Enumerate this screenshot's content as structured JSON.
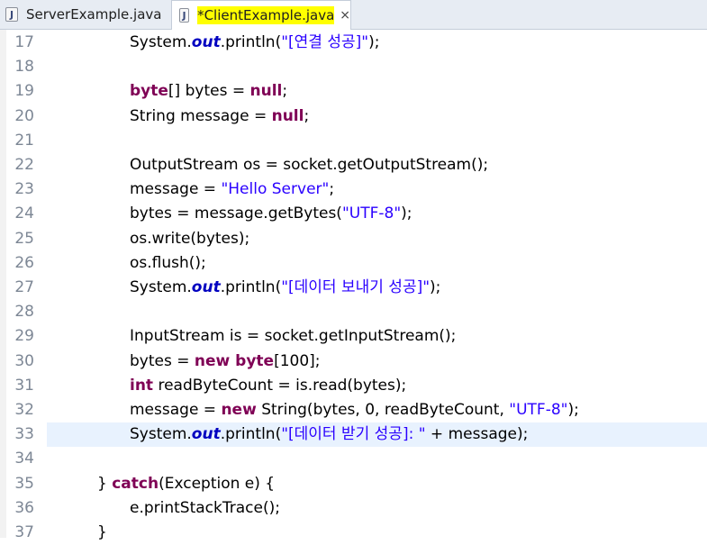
{
  "tabs": [
    {
      "label": "ServerExample.java",
      "icon": "java-file-icon"
    },
    {
      "label": "*ClientExample.java",
      "icon": "java-file-icon",
      "close": "⨯"
    }
  ],
  "lines": [
    {
      "num": "17",
      "indent": 2,
      "tokens": [
        [
          "t",
          "System."
        ],
        [
          "f",
          "out"
        ],
        [
          "t",
          ".println("
        ],
        [
          "s",
          "\"[연결 성공]\""
        ],
        [
          "t",
          ");"
        ]
      ]
    },
    {
      "num": "18",
      "indent": 2,
      "tokens": []
    },
    {
      "num": "19",
      "indent": 2,
      "tokens": [
        [
          "k",
          "byte"
        ],
        [
          "t",
          "[] bytes = "
        ],
        [
          "k",
          "null"
        ],
        [
          "t",
          ";"
        ]
      ]
    },
    {
      "num": "20",
      "indent": 2,
      "tokens": [
        [
          "t",
          "String message = "
        ],
        [
          "k",
          "null"
        ],
        [
          "t",
          ";"
        ]
      ]
    },
    {
      "num": "21",
      "indent": 2,
      "tokens": []
    },
    {
      "num": "22",
      "indent": 2,
      "tokens": [
        [
          "t",
          "OutputStream os = socket.getOutputStream();"
        ]
      ]
    },
    {
      "num": "23",
      "indent": 2,
      "tokens": [
        [
          "t",
          "message = "
        ],
        [
          "s",
          "\"Hello Server\""
        ],
        [
          "t",
          ";"
        ]
      ]
    },
    {
      "num": "24",
      "indent": 2,
      "tokens": [
        [
          "t",
          "bytes = message.getBytes("
        ],
        [
          "s",
          "\"UTF-8\""
        ],
        [
          "t",
          ");"
        ]
      ]
    },
    {
      "num": "25",
      "indent": 2,
      "tokens": [
        [
          "t",
          "os.write(bytes);"
        ]
      ]
    },
    {
      "num": "26",
      "indent": 2,
      "tokens": [
        [
          "t",
          "os.flush();"
        ]
      ]
    },
    {
      "num": "27",
      "indent": 2,
      "tokens": [
        [
          "t",
          "System."
        ],
        [
          "f",
          "out"
        ],
        [
          "t",
          ".println("
        ],
        [
          "s",
          "\"[데이터 보내기 성공]\""
        ],
        [
          "t",
          ");"
        ]
      ]
    },
    {
      "num": "28",
      "indent": 2,
      "tokens": []
    },
    {
      "num": "29",
      "indent": 2,
      "tokens": [
        [
          "t",
          "InputStream is = socket.getInputStream();"
        ]
      ]
    },
    {
      "num": "30",
      "indent": 2,
      "tokens": [
        [
          "t",
          "bytes = "
        ],
        [
          "k",
          "new byte"
        ],
        [
          "t",
          "[100];"
        ]
      ]
    },
    {
      "num": "31",
      "indent": 2,
      "tokens": [
        [
          "k",
          "int"
        ],
        [
          "t",
          " readByteCount = is.read(bytes);"
        ]
      ]
    },
    {
      "num": "32",
      "indent": 2,
      "tokens": [
        [
          "t",
          "message = "
        ],
        [
          "k",
          "new"
        ],
        [
          "t",
          " String(bytes, 0, readByteCount, "
        ],
        [
          "s",
          "\"UTF-8\""
        ],
        [
          "t",
          ");"
        ]
      ]
    },
    {
      "num": "33",
      "indent": 2,
      "current": true,
      "tokens": [
        [
          "t",
          "System."
        ],
        [
          "f",
          "out"
        ],
        [
          "t",
          ".println("
        ],
        [
          "s",
          "\"[데이터 받기 성공]: \""
        ],
        [
          "t",
          " + message);"
        ]
      ]
    },
    {
      "num": "34",
      "indent": 2,
      "tokens": []
    },
    {
      "num": "35",
      "indent": 1,
      "tokens": [
        [
          "t",
          "} "
        ],
        [
          "k",
          "catch"
        ],
        [
          "t",
          "(Exception e) {"
        ]
      ]
    },
    {
      "num": "36",
      "indent": 2,
      "tokens": [
        [
          "t",
          "e.printStackTrace();"
        ]
      ]
    },
    {
      "num": "37",
      "indent": 1,
      "tokens": [
        [
          "t",
          "}"
        ]
      ]
    }
  ]
}
